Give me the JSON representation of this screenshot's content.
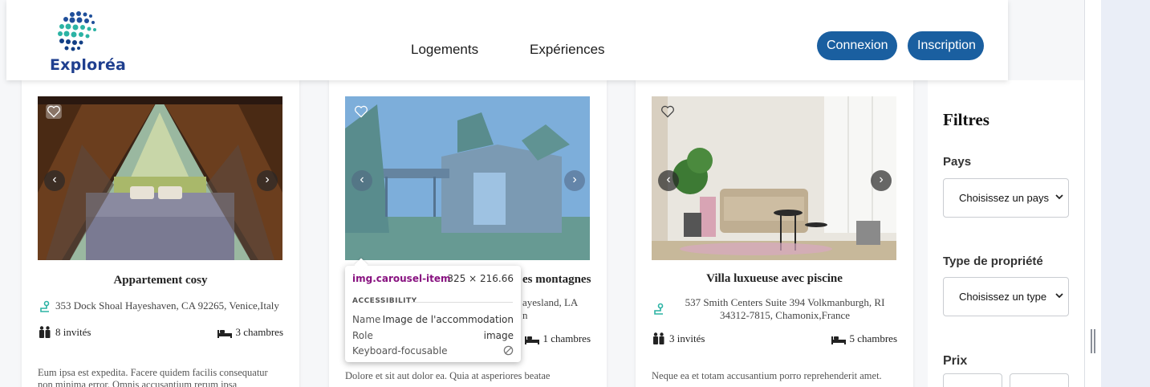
{
  "brand": {
    "name": "Exploréa"
  },
  "nav": {
    "logements": "Logements",
    "experiences": "Expériences"
  },
  "auth": {
    "login": "Connexion",
    "signup": "Inscription"
  },
  "cards": [
    {
      "title": "Appartement cosy",
      "address": "353 Dock Shoal Hayeshaven, CA 92265, Venice,Italy",
      "guests": "8 invités",
      "bedrooms": "3 chambres",
      "description": "Eum ipsa est expedita. Facere quidem facilis consequatur non minima error. Omnis accusantium rerum ipsa"
    },
    {
      "title": "es montagnes",
      "address": "ayesland, LA",
      "address2": "n",
      "bedrooms": "1 chambres",
      "description": "Dolore et sit aut dolor ea. Quia at asperiores beatae"
    },
    {
      "title": "Villa luxueuse avec piscine",
      "address": "537 Smith Centers Suite 394 Volkmanburgh, RI 34312-7815, Chamonix,France",
      "guests": "3 invités",
      "bedrooms": "5 chambres",
      "description": "Neque ea et totam accusantium porro reprehenderit amet."
    }
  ],
  "tooltip": {
    "selector": "img.carousel-item",
    "size": "325 × 216.66",
    "section": "ACCESSIBILITY",
    "name_label": "Name",
    "name_value": "Image de l'accommodation",
    "role_label": "Role",
    "role_value": "image",
    "focus_label": "Keyboard-focusable"
  },
  "filters": {
    "title": "Filtres",
    "country_label": "Pays",
    "country_placeholder": "Choisissez un pays",
    "type_label": "Type de propriété",
    "type_placeholder": "Choisissez un type",
    "price_label": "Prix"
  },
  "colors": {
    "brand_blue": "#1a5fa0",
    "logo_text": "#1f3f8f",
    "teal_icon": "#2bb3a4"
  }
}
